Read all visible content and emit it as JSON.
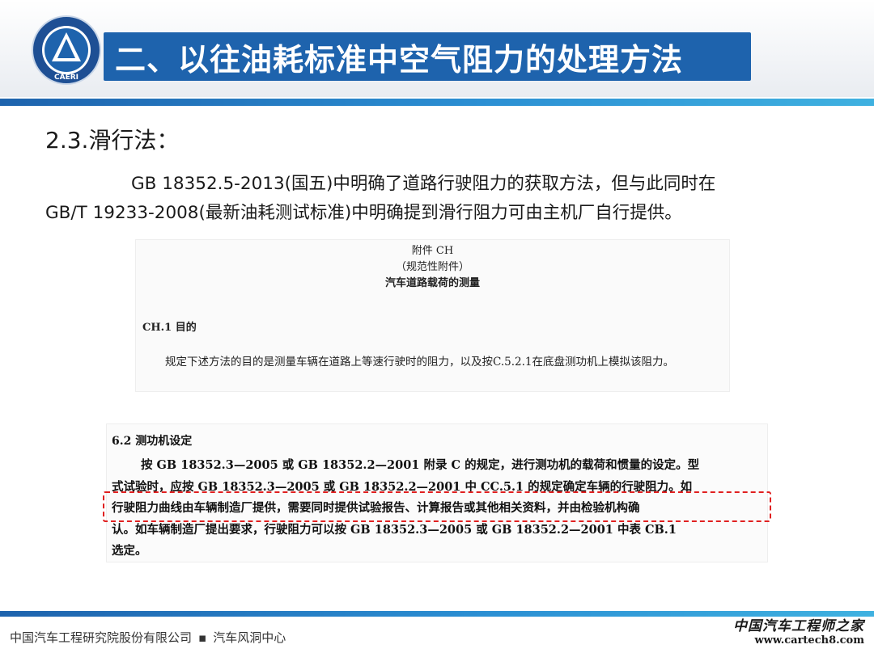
{
  "header": {
    "title": "二、以往油耗标准中空气阻力的处理方法",
    "logo_text": "CAERI"
  },
  "section": {
    "heading": "2.3.滑行法："
  },
  "paragraph": {
    "line1": "GB 18352.5-2013(国五)中明确了道路行驶阻力的获取方法，但与此同时在",
    "line2": "GB/T 19233-2008(最新油耗测试标准)中明确提到滑行阻力可由主机厂自行提供。"
  },
  "excerpt1": {
    "title1": "附件  CH",
    "title2": "（规范性附件）",
    "title3": "汽车道路载荷的测量",
    "section_no": "CH.1  目的",
    "body": "规定下述方法的目的是测量车辆在道路上等速行驶时的阻力，以及按C.5.2.1在底盘测功机上模拟该阻力。"
  },
  "excerpt2": {
    "section_no": "6.2    测功机设定",
    "line1": "按 GB 18352.3—2005 或 GB 18352.2—2001 附录 C 的规定，进行测功机的载荷和惯量的设定。型",
    "line2": "式试验时，应按 GB 18352.3—2005 或 GB 18352.2—2001 中 CC.5.1 的规定确定车辆的行驶阻力。如",
    "line3": "行驶阻力曲线由车辆制造厂提供，需要同时提供试验报告、计算报告或其他相关资料，并由检验机构确",
    "line4": "认。如车辆制造厂提出要求，行驶阻力可以按 GB 18352.3—2005 或 GB 18352.2—2001 中表 CB.1",
    "line5": "选定。"
  },
  "footer": {
    "company": "中国汽车工程研究院股份有限公司",
    "separator": "▪",
    "center": "汽车风洞中心"
  },
  "watermark": {
    "name": "中国汽车工程师之家",
    "url": "www.cartech8.com"
  },
  "colors": {
    "accent": "#1e63ad",
    "highlight": "#e02020"
  }
}
